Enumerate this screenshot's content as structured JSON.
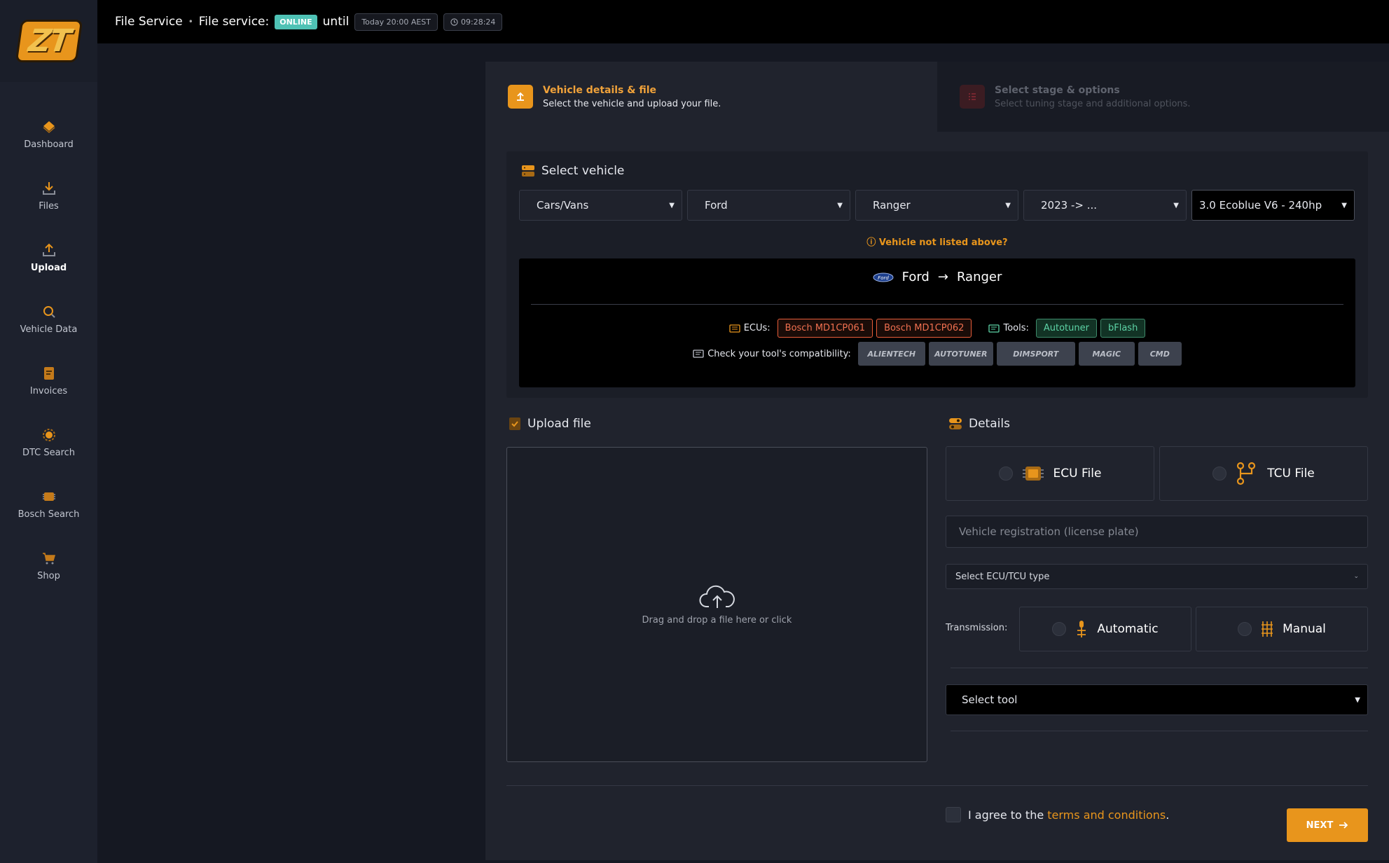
{
  "brand": {
    "logo_text": "ZT"
  },
  "sidebar": {
    "items": [
      {
        "label": "Dashboard"
      },
      {
        "label": "Files"
      },
      {
        "label": "Upload"
      },
      {
        "label": "Vehicle Data"
      },
      {
        "label": "Invoices"
      },
      {
        "label": "DTC Search"
      },
      {
        "label": "Bosch Search"
      },
      {
        "label": "Shop"
      }
    ],
    "active": "Upload"
  },
  "topbar": {
    "title": "File Service",
    "separator": "•",
    "status_label": "File service:",
    "status_badge": "ONLINE",
    "until_label": "until",
    "until_time": "Today 20:00 AEST",
    "clock": "09:28:24"
  },
  "steps": [
    {
      "title": "Vehicle details & file",
      "subtitle": "Select the vehicle and upload your file."
    },
    {
      "title": "Select stage & options",
      "subtitle": "Select tuning stage and additional options."
    }
  ],
  "vehicle": {
    "heading": "Select vehicle",
    "selects": [
      "Cars/Vans",
      "Ford",
      "Ranger",
      "2023 -> ...",
      "3.0 Ecoblue V6 - 240hp"
    ],
    "not_listed": "Vehicle not listed above?",
    "summary_make": "Ford",
    "summary_arrow": "→",
    "summary_model": "Ranger",
    "ecus_label": "ECUs:",
    "ecus": [
      "Bosch MD1CP061",
      "Bosch MD1CP062"
    ],
    "tools_label": "Tools:",
    "tools": [
      "Autotuner",
      "bFlash"
    ],
    "compat_label": "Check your tool's compatibility:",
    "compat_tools": [
      "ALIENTECH",
      "AUTOTUNER",
      "DIMSPORT",
      "MAGIC",
      "CMD"
    ]
  },
  "upload": {
    "heading": "Upload file",
    "drop_text": "Drag and drop a file here or click"
  },
  "details": {
    "heading": "Details",
    "file_types": [
      "ECU File",
      "TCU File"
    ],
    "registration_placeholder": "Vehicle registration (license plate)",
    "ecu_type_placeholder": "Select ECU/TCU type",
    "transmission_label": "Transmission:",
    "transmission_options": [
      "Automatic",
      "Manual"
    ],
    "tool_placeholder": "Select tool",
    "agree_prefix": "I agree to the",
    "agree_link": "terms and conditions",
    "agree_suffix": "."
  },
  "actions": {
    "next": "NEXT"
  },
  "colors": {
    "accent": "#e8951c",
    "online": "#4fc2b5",
    "ecu_tag": "#e85d3a",
    "tool_tag": "#5dd3a6"
  }
}
